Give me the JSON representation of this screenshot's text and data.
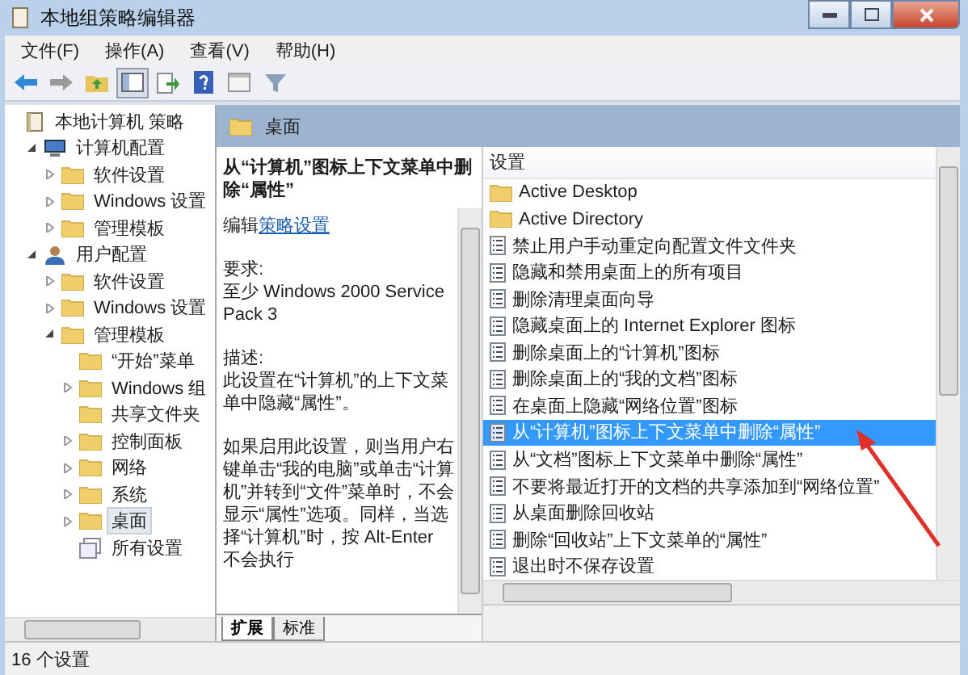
{
  "window": {
    "title": "本地组策略编辑器"
  },
  "menu": [
    "文件(F)",
    "操作(A)",
    "查看(V)",
    "帮助(H)"
  ],
  "toolbar": [
    {
      "kind": "back",
      "pressed": false
    },
    {
      "kind": "forward",
      "pressed": false
    },
    {
      "kind": "up",
      "pressed": false
    },
    {
      "kind": "tree",
      "pressed": true
    },
    {
      "kind": "export",
      "pressed": false
    },
    {
      "kind": "help",
      "pressed": false
    },
    {
      "kind": "console",
      "pressed": false
    },
    {
      "kind": "filter",
      "pressed": false
    }
  ],
  "tree": [
    {
      "label": "本地计算机 策略",
      "kind": "policy",
      "selected": false,
      "children": [
        {
          "label": "计算机配置",
          "kind": "computer",
          "selected": false,
          "expanded": true,
          "children": [
            {
              "label": "软件设置",
              "kind": "folder",
              "selected": false,
              "expanded": false
            },
            {
              "label": "Windows 设置",
              "kind": "folder",
              "selected": false,
              "expanded": false
            },
            {
              "label": "管理模板",
              "kind": "folder",
              "selected": false,
              "expanded": false
            }
          ]
        },
        {
          "label": "用户配置",
          "kind": "user",
          "selected": false,
          "expanded": true,
          "children": [
            {
              "label": "软件设置",
              "kind": "folder",
              "selected": false,
              "expanded": false
            },
            {
              "label": "Windows 设置",
              "kind": "folder",
              "selected": false,
              "expanded": false
            },
            {
              "label": "管理模板",
              "kind": "folder",
              "selected": false,
              "expanded": true,
              "children": [
                {
                  "label": "“开始”菜单",
                  "kind": "folder",
                  "selected": false
                },
                {
                  "label": "Windows 组",
                  "kind": "folder",
                  "selected": false,
                  "expanded": false
                },
                {
                  "label": "共享文件夹",
                  "kind": "folder",
                  "selected": false
                },
                {
                  "label": "控制面板",
                  "kind": "folder",
                  "selected": false,
                  "expanded": false
                },
                {
                  "label": "网络",
                  "kind": "folder",
                  "selected": false,
                  "expanded": false
                },
                {
                  "label": "系统",
                  "kind": "folder",
                  "selected": false,
                  "expanded": false
                },
                {
                  "label": "桌面",
                  "kind": "folder",
                  "selected": true,
                  "expanded": false
                },
                {
                  "label": "所有设置",
                  "kind": "settings",
                  "selected": false
                }
              ]
            }
          ]
        }
      ]
    }
  ],
  "header": {
    "title": "桌面"
  },
  "description": {
    "title": "从“计算机”图标上下文菜单中删除“属性”",
    "edit_prefix": "编辑",
    "edit_link": "策略设置",
    "requirements_label": "要求:",
    "requirements": "至少 Windows 2000 Service Pack 3",
    "description_label": "描述:",
    "description": "此设置在“计算机”的上下文菜单中隐藏“属性”。",
    "detail": "如果启用此设置，则当用户右键单击“我的电脑”或单击“计算机”并转到“文件”菜单时，不会显示“属性”选项。同样，当选择“计算机”时，按 Alt-Enter 不会执行"
  },
  "list": {
    "column": "设置",
    "items": [
      {
        "label": "Active Desktop",
        "kind": "folder",
        "selected": false
      },
      {
        "label": "Active Directory",
        "kind": "folder",
        "selected": false
      },
      {
        "label": "禁止用户手动重定向配置文件文件夹",
        "kind": "setting",
        "selected": false
      },
      {
        "label": "隐藏和禁用桌面上的所有项目",
        "kind": "setting",
        "selected": false
      },
      {
        "label": "删除清理桌面向导",
        "kind": "setting",
        "selected": false
      },
      {
        "label": "隐藏桌面上的 Internet Explorer 图标",
        "kind": "setting",
        "selected": false
      },
      {
        "label": "删除桌面上的“计算机”图标",
        "kind": "setting",
        "selected": false
      },
      {
        "label": "删除桌面上的“我的文档”图标",
        "kind": "setting",
        "selected": false
      },
      {
        "label": "在桌面上隐藏“网络位置”图标",
        "kind": "setting",
        "selected": false
      },
      {
        "label": "从“计算机”图标上下文菜单中删除“属性”",
        "kind": "setting",
        "selected": true
      },
      {
        "label": "从“文档”图标上下文菜单中删除“属性”",
        "kind": "setting",
        "selected": false
      },
      {
        "label": "不要将最近打开的文档的共享添加到“网络位置”",
        "kind": "setting",
        "selected": false
      },
      {
        "label": "从桌面删除回收站",
        "kind": "setting",
        "selected": false
      },
      {
        "label": "删除“回收站”上下文菜单的“属性”",
        "kind": "setting",
        "selected": false
      },
      {
        "label": "退出时不保存设置",
        "kind": "setting",
        "selected": false
      }
    ]
  },
  "tabs": [
    {
      "label": "扩展",
      "selected": true
    },
    {
      "label": "标准",
      "selected": false
    }
  ],
  "status_bar": "16 个设置"
}
